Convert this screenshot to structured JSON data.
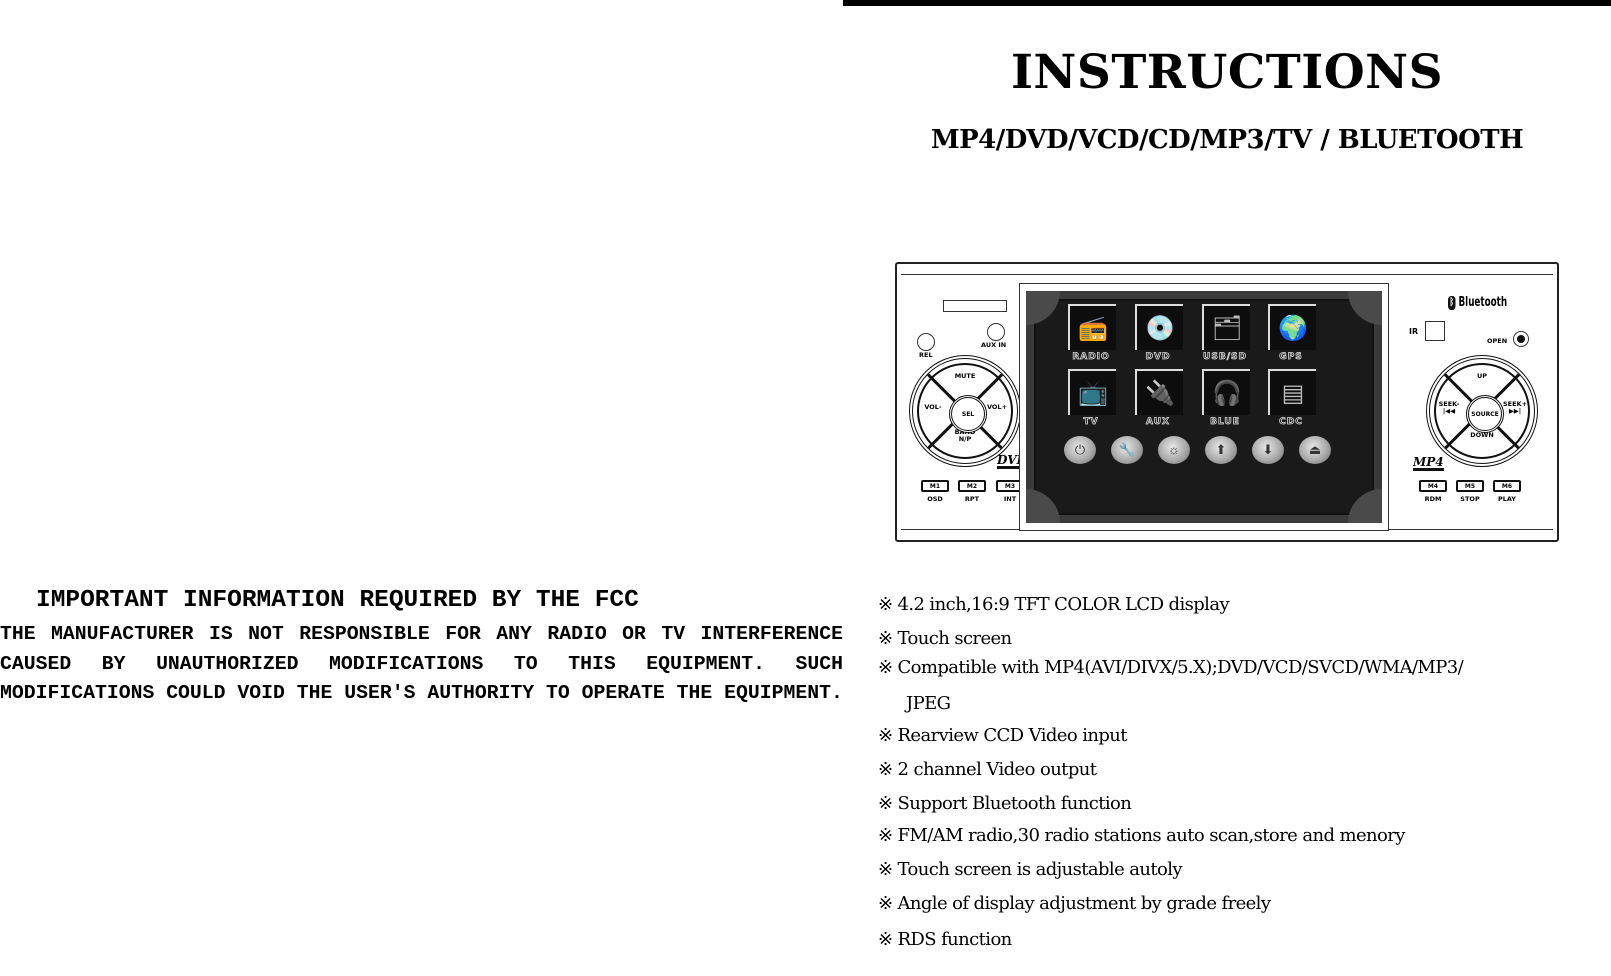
{
  "header": {
    "title": "INSTRUCTIONS",
    "subtitle": "MP4/DVD/VCD/CD/MP3/TV / BLUETOOTH"
  },
  "device": {
    "left_panel": {
      "knob_left_label": "REL",
      "knob_right_label": "AUX IN",
      "dpad": {
        "up": "MUTE",
        "left": "VOL-",
        "right": "VOL+",
        "down": "BAND N/P",
        "center": "SEL"
      },
      "badge": "DVD",
      "buttons": [
        {
          "label": "M1",
          "caption": "OSD"
        },
        {
          "label": "M2",
          "caption": "RPT"
        },
        {
          "label": "M3",
          "caption": "INT"
        }
      ]
    },
    "screen": {
      "tiles": [
        {
          "label": "RADIO",
          "icon": "radio-icon",
          "glyph": "📻"
        },
        {
          "label": "DVD",
          "icon": "disc-icon",
          "glyph": "💿"
        },
        {
          "label": "USB/SD",
          "icon": "usb-sd-icon",
          "glyph": "🗂"
        },
        {
          "label": "GPS",
          "icon": "globe-icon",
          "glyph": "🌍"
        },
        {
          "label": "TV",
          "icon": "tv-icon",
          "glyph": "📺"
        },
        {
          "label": "AUX",
          "icon": "aux-cables-icon",
          "glyph": "🔌"
        },
        {
          "label": "BLUE",
          "icon": "bluetooth-headset-icon",
          "glyph": "🎧"
        },
        {
          "label": "CDC",
          "icon": "cd-changer-icon",
          "glyph": "▤"
        }
      ],
      "controls": [
        {
          "name": "power-icon",
          "glyph": "⏻"
        },
        {
          "name": "settings-wrench-icon",
          "glyph": "🔧"
        },
        {
          "name": "brightness-icon",
          "glyph": "☼"
        },
        {
          "name": "arrow-up-icon",
          "glyph": "⬆"
        },
        {
          "name": "arrow-down-icon",
          "glyph": "⬇"
        },
        {
          "name": "eject-icon",
          "glyph": "⏏"
        }
      ]
    },
    "right_panel": {
      "bluetooth_label": "Bluetooth",
      "bluetooth_glyph": "ᛒ",
      "ir_label": "IR",
      "open_label": "OPEN",
      "dpad": {
        "up": "UP",
        "left": "SEEK- |◀◀",
        "right": "SEEK+ ▶▶|",
        "down": "DOWN",
        "center": "SOURCE"
      },
      "badge": "MP4",
      "buttons": [
        {
          "label": "M4",
          "caption": "RDM"
        },
        {
          "label": "M5",
          "caption": "STOP"
        },
        {
          "label": "M6",
          "caption": "PLAY"
        }
      ]
    }
  },
  "features": {
    "marker": "※",
    "items": [
      "4.2 inch,16:9 TFT COLOR LCD display",
      "Touch screen",
      "Compatible with MP4(AVI/DIVX/5.X);DVD/VCD/SVCD/WMA/MP3/",
      "JPEG",
      "Rearview CCD Video input",
      "2 channel Video output",
      "Support Bluetooth function",
      "FM/AM radio,30 radio stations auto scan,store and menory",
      "Touch screen is adjustable autoly",
      "Angle of display adjustment by grade freely",
      "RDS function"
    ]
  },
  "fcc": {
    "title": "IMPORTANT INFORMATION REQUIRED BY THE FCC",
    "body": "THE MANUFACTURER IS NOT RESPONSIBLE FOR ANY RADIO OR TV INTERFERENCE CAUSED BY UNAUTHORIZED MODIFICATIONS TO THIS EQUIPMENT. SUCH MODIFICATIONS COULD VOID THE USER'S AUTHORITY TO OPERATE THE EQUIPMENT."
  }
}
